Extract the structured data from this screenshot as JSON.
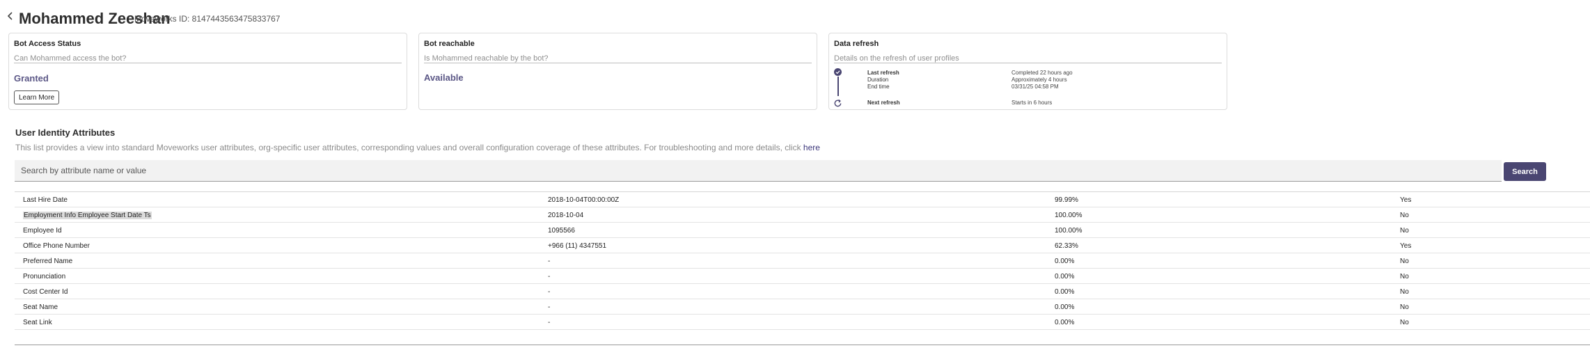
{
  "header": {
    "user_name": "Mohammed Zeeshan",
    "user_id": "Moveworks ID: 8147443563475833767"
  },
  "cards": {
    "bot_access": {
      "title": "Bot Access Status",
      "description": "Can Mohammed access the bot?",
      "status": "Granted",
      "button_label": "Learn More"
    },
    "bot_reachable": {
      "title": "Bot reachable",
      "description": "Is Mohammed reachable by the bot?",
      "status": "Available"
    },
    "data_refresh": {
      "title": "Data refresh",
      "description": "Details on the refresh of user profiles",
      "last_refresh_label": "Last refresh",
      "last_refresh_value": "Completed 22 hours ago",
      "duration_label": "Duration",
      "duration_value": "Approximately 4 hours",
      "end_time_label": "End time",
      "end_time_value": "03/31/25 04:58 PM",
      "next_refresh_label": "Next refresh",
      "next_refresh_value": "Starts in 6 hours"
    }
  },
  "attributes_section": {
    "title": "User Identity Attributes",
    "description": "This list provides a view into standard Moveworks user attributes, org-specific user attributes, corresponding values and overall configuration coverage of these attributes. For troubleshooting and more details, click ",
    "link_text": "here",
    "search_placeholder": "Search by attribute name or value",
    "search_button": "Search"
  },
  "table": {
    "rows": [
      {
        "name": "Last Hire Date",
        "value": "2018-10-04T00:00:00Z",
        "coverage": "99.99%",
        "flag": "Yes"
      },
      {
        "name": "Employment Info Employee Start Date Ts",
        "value": "2018-10-04",
        "coverage": "100.00%",
        "flag": "No"
      },
      {
        "name": "Employee Id",
        "value": "1095566",
        "coverage": "100.00%",
        "flag": "No"
      },
      {
        "name": "Office Phone Number",
        "value": "+966 (11) 4347551",
        "coverage": "62.33%",
        "flag": "Yes"
      },
      {
        "name": "Preferred Name",
        "value": "-",
        "coverage": "0.00%",
        "flag": "No"
      },
      {
        "name": "Pronunciation",
        "value": "-",
        "coverage": "0.00%",
        "flag": "No"
      },
      {
        "name": "Cost Center Id",
        "value": "-",
        "coverage": "0.00%",
        "flag": "No"
      },
      {
        "name": "Seat Name",
        "value": "-",
        "coverage": "0.00%",
        "flag": "No"
      },
      {
        "name": "Seat Link",
        "value": "-",
        "coverage": "0.00%",
        "flag": "No"
      }
    ]
  },
  "icons": {
    "back": "chevron-left-icon",
    "check": "check-circle-icon",
    "refresh": "refresh-icon"
  },
  "colors": {
    "accent": "#4a4672",
    "status_text": "#5b5786",
    "link": "#3a3479"
  }
}
